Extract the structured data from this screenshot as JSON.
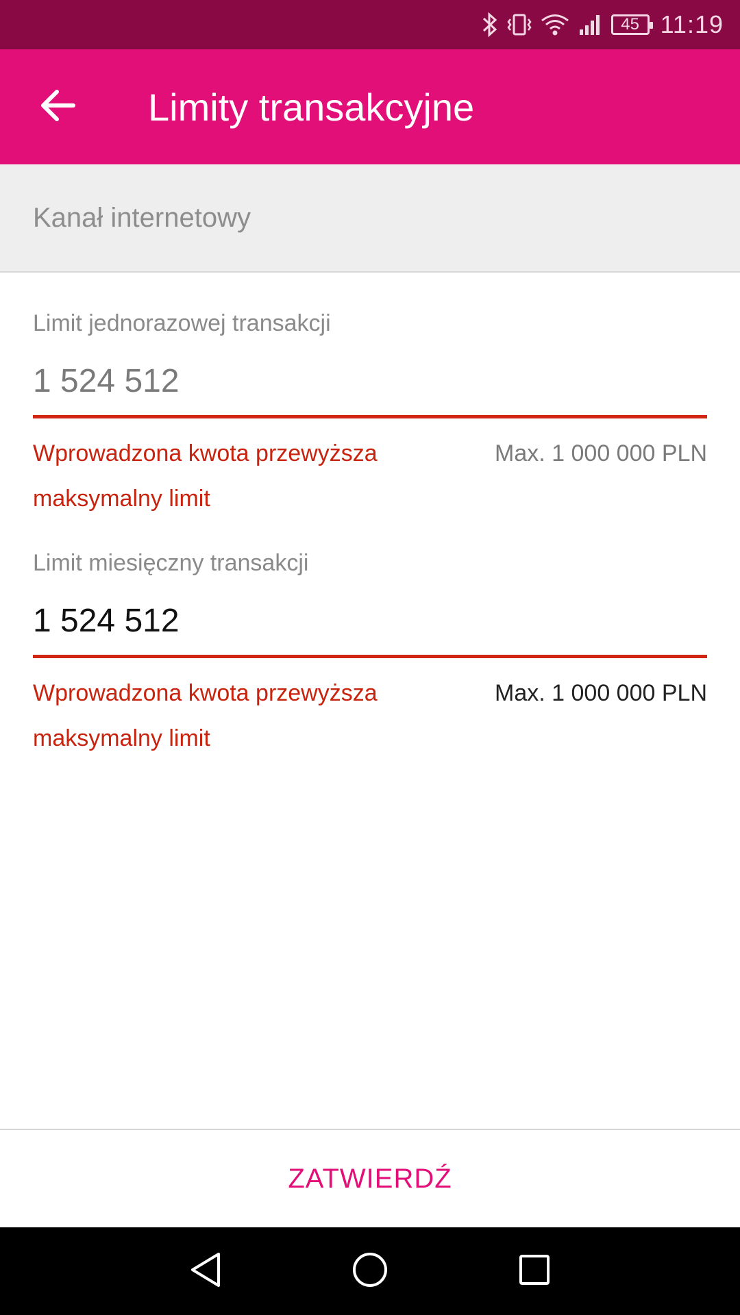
{
  "status_bar": {
    "time": "11:19",
    "battery": "45",
    "icons": [
      "bluetooth-icon",
      "vibrate-icon",
      "wifi-icon",
      "signal-icon",
      "battery-icon"
    ]
  },
  "header": {
    "title": "Limity transakcyjne",
    "back_icon": "arrow-left-icon"
  },
  "section": {
    "title": "Kanał internetowy"
  },
  "fields": [
    {
      "label": "Limit jednorazowej transakcji",
      "value": "1 524 512",
      "error": "Wprowadzona kwota przewyższa maksymalny limit",
      "max": "Max. 1 000 000 PLN"
    },
    {
      "label": "Limit miesięczny transakcji",
      "value": "1 524 512",
      "error": "Wprowadzona kwota przewyższa maksymalny limit",
      "max": "Max. 1 000 000 PLN"
    }
  ],
  "footer": {
    "confirm_label": "ZATWIERDŹ"
  },
  "nav_bar": {
    "icons": [
      "back-triangle-icon",
      "home-circle-icon",
      "recents-square-icon"
    ]
  },
  "colors": {
    "status_bar": "#880944",
    "app_bar": "#e20f78",
    "error": "#c7230e",
    "accent": "#e20f78"
  }
}
